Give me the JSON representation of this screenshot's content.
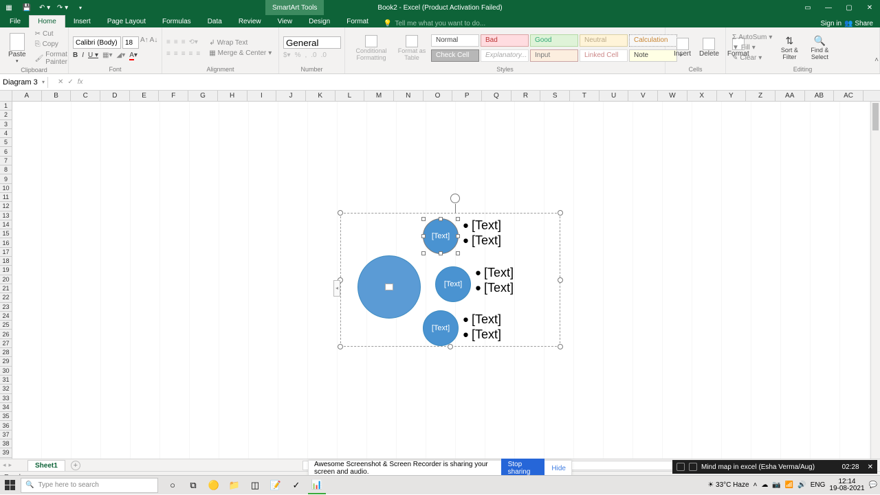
{
  "titlebar": {
    "smartart_tools": "SmartArt Tools",
    "title": "Book2 - Excel (Product Activation Failed)"
  },
  "tabs": {
    "file": "File",
    "home": "Home",
    "insert": "Insert",
    "page_layout": "Page Layout",
    "formulas": "Formulas",
    "data": "Data",
    "review": "Review",
    "view": "View",
    "design": "Design",
    "format": "Format",
    "tellme": "Tell me what you want to do...",
    "signin": "Sign in",
    "share": "Share"
  },
  "ribbon": {
    "clipboard": {
      "label": "Clipboard",
      "paste": "Paste",
      "cut": "Cut",
      "copy": "Copy",
      "painter": "Format Painter"
    },
    "font": {
      "label": "Font",
      "name": "Calibri (Body)",
      "size": "18"
    },
    "alignment": {
      "label": "Alignment",
      "wrap": "Wrap Text",
      "merge": "Merge & Center"
    },
    "number": {
      "label": "Number",
      "format": "General"
    },
    "styles": {
      "label": "Styles",
      "conditional": "Conditional Formatting",
      "table": "Format as Table",
      "normal": "Normal",
      "bad": "Bad",
      "good": "Good",
      "neutral": "Neutral",
      "calculation": "Calculation",
      "check": "Check Cell",
      "explanatory": "Explanatory...",
      "input": "Input",
      "linked": "Linked Cell",
      "note": "Note"
    },
    "cells": {
      "label": "Cells",
      "insert": "Insert",
      "delete": "Delete",
      "format": "Format"
    },
    "editing": {
      "label": "Editing",
      "autosum": "AutoSum",
      "fill": "Fill",
      "clear": "Clear",
      "sort": "Sort & Filter",
      "find": "Find & Select"
    }
  },
  "formulabar": {
    "name": "Diagram 3"
  },
  "columns": [
    "A",
    "B",
    "C",
    "D",
    "E",
    "F",
    "G",
    "H",
    "I",
    "J",
    "K",
    "L",
    "M",
    "N",
    "O",
    "P",
    "Q",
    "R",
    "S",
    "T",
    "U",
    "V",
    "W",
    "X",
    "Y",
    "Z",
    "AA",
    "AB",
    "AC"
  ],
  "rows": 39,
  "smartart": {
    "placeholder": "[Text]"
  },
  "sheet_tabs": {
    "sheet1": "Sheet1"
  },
  "statusbar": {
    "ready": "Ready"
  },
  "sharing": {
    "msg": "Awesome Screenshot & Screen Recorder is sharing your screen and audio.",
    "stop": "Stop sharing",
    "hide": "Hide"
  },
  "teams": {
    "text": "Mind map in excel (Esha Verma/Aug)",
    "time": "02:28"
  },
  "taskbar": {
    "search_placeholder": "Type here to search",
    "weather": "33°C Haze",
    "date": "19-08-2021",
    "time": "12:14",
    "lang": "ENG"
  }
}
